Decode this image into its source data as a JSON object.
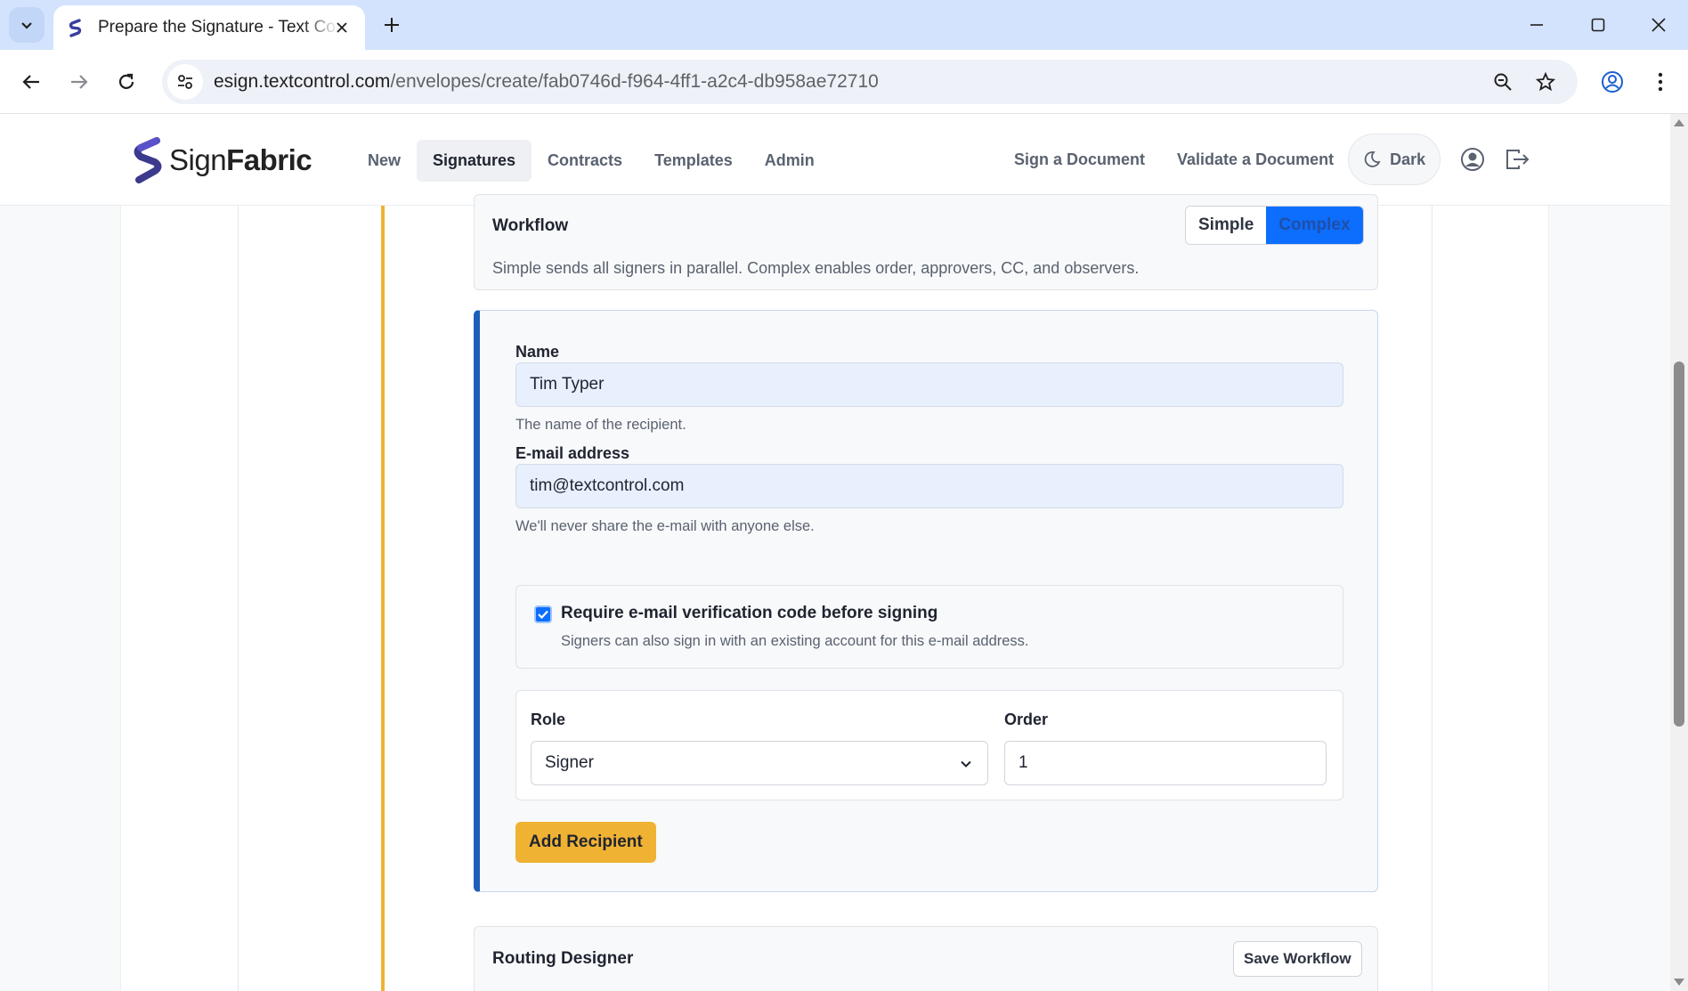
{
  "browser": {
    "tab_title": "Prepare the Signature - Text Control",
    "url_host": "esign.textcontrol.com",
    "url_path": "/envelopes/create/fab0746d-f964-4ff1-a2c4-db958ae72710",
    "icons": [
      "tab-search-icon",
      "close-icon",
      "plus-icon",
      "minimize-icon",
      "maximize-icon",
      "window-close-icon",
      "back-icon",
      "forward-icon",
      "reload-icon",
      "site-info-icon",
      "zoom-icon",
      "bookmark-star-icon",
      "profile-icon",
      "menu-kebab-icon"
    ]
  },
  "header": {
    "logo_sign": "Sign",
    "logo_fabric": "Fabric",
    "nav": [
      {
        "label": "New",
        "active": false
      },
      {
        "label": "Signatures",
        "active": true
      },
      {
        "label": "Contracts",
        "active": false
      },
      {
        "label": "Templates",
        "active": false
      },
      {
        "label": "Admin",
        "active": false
      }
    ],
    "sign_document": "Sign a Document",
    "validate_document": "Validate a Document",
    "theme_label": "Dark"
  },
  "workflow": {
    "title": "Workflow",
    "options": [
      "Simple",
      "Complex"
    ],
    "selected": "Complex",
    "description": "Simple sends all signers in parallel. Complex enables order, approvers, CC, and observers."
  },
  "recipient": {
    "name_label": "Name",
    "name_value": "Tim Typer",
    "name_help": "The name of the recipient.",
    "email_label": "E-mail address",
    "email_value": "tim@textcontrol.com",
    "email_help": "We'll never share the e-mail with anyone else.",
    "verify_checked": true,
    "verify_label": "Require e-mail verification code before signing",
    "verify_desc": "Signers can also sign in with an existing account for this e-mail address.",
    "role_label": "Role",
    "role_value": "Signer",
    "order_label": "Order",
    "order_value": "1",
    "add_button": "Add Recipient"
  },
  "routing": {
    "title": "Routing Designer",
    "save_button": "Save Workflow"
  },
  "colors": {
    "primary": "#0d6efd",
    "accent": "#f0b233",
    "recipient_border": "#1d5fb8"
  }
}
